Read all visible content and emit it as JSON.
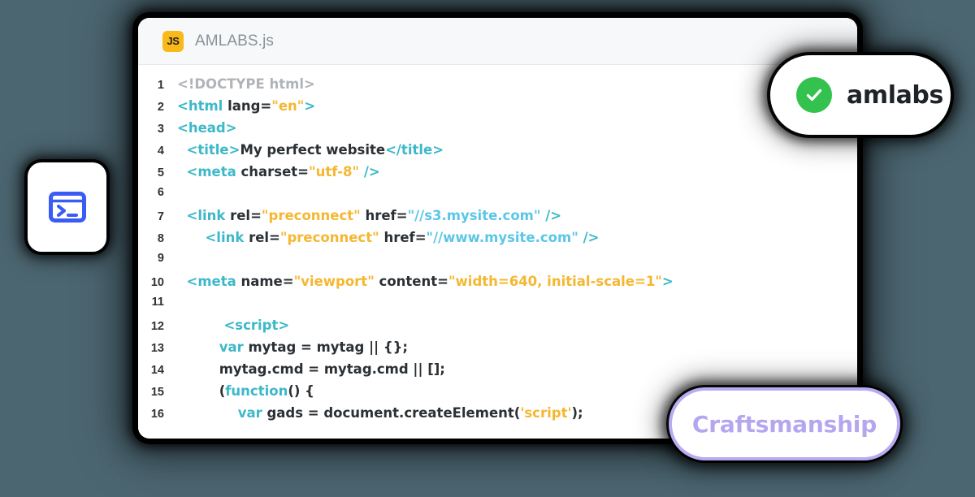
{
  "background_color": "#4c6671",
  "editor": {
    "file_badge": "JS",
    "file_badge_color": "#f9b918",
    "title": "AMLABS.js",
    "lines": [
      {
        "n": "1",
        "tokens": [
          {
            "t": "doctype",
            "v": "<!DOCTYPE html>"
          }
        ]
      },
      {
        "n": "2",
        "tokens": [
          {
            "t": "tag",
            "v": "<html "
          },
          {
            "t": "attr",
            "v": "lang="
          },
          {
            "t": "str",
            "v": "\"en\""
          },
          {
            "t": "tag",
            "v": ">"
          }
        ]
      },
      {
        "n": "3",
        "tokens": [
          {
            "t": "tag",
            "v": "<head>"
          }
        ]
      },
      {
        "n": "4",
        "tokens": [
          {
            "t": "plain",
            "v": "  "
          },
          {
            "t": "tag",
            "v": "<title>"
          },
          {
            "t": "plain",
            "v": "My perfect website"
          },
          {
            "t": "tag",
            "v": "</title>"
          }
        ]
      },
      {
        "n": "5",
        "tokens": [
          {
            "t": "plain",
            "v": "  "
          },
          {
            "t": "tag",
            "v": "<meta "
          },
          {
            "t": "attr",
            "v": "charset="
          },
          {
            "t": "str",
            "v": "\"utf-8\""
          },
          {
            "t": "plain",
            "v": " "
          },
          {
            "t": "tag",
            "v": "/>"
          }
        ]
      },
      {
        "n": "6",
        "tokens": []
      },
      {
        "n": "7",
        "tokens": [
          {
            "t": "plain",
            "v": "  "
          },
          {
            "t": "tag",
            "v": "<link "
          },
          {
            "t": "attr",
            "v": "rel="
          },
          {
            "t": "str",
            "v": "\"preconnect\""
          },
          {
            "t": "plain",
            "v": " "
          },
          {
            "t": "attr",
            "v": "href="
          },
          {
            "t": "url",
            "v": "\"//s3.mysite.com\""
          },
          {
            "t": "plain",
            "v": " "
          },
          {
            "t": "tag",
            "v": "/>"
          }
        ]
      },
      {
        "n": "8",
        "tokens": [
          {
            "t": "plain",
            "v": "      "
          },
          {
            "t": "tag",
            "v": "<link "
          },
          {
            "t": "attr",
            "v": "rel="
          },
          {
            "t": "str",
            "v": "\"preconnect\""
          },
          {
            "t": "plain",
            "v": " "
          },
          {
            "t": "attr",
            "v": "href="
          },
          {
            "t": "url",
            "v": "\"//www.mysite.com\""
          },
          {
            "t": "plain",
            "v": " "
          },
          {
            "t": "tag",
            "v": "/>"
          }
        ]
      },
      {
        "n": "9",
        "tokens": []
      },
      {
        "n": "10",
        "tokens": [
          {
            "t": "plain",
            "v": "  "
          },
          {
            "t": "tag",
            "v": "<meta "
          },
          {
            "t": "attr",
            "v": "name="
          },
          {
            "t": "str",
            "v": "\"viewport\""
          },
          {
            "t": "plain",
            "v": " "
          },
          {
            "t": "attr",
            "v": "content="
          },
          {
            "t": "str",
            "v": "\"width=640, initial-scale=1\""
          },
          {
            "t": "tag",
            "v": ">"
          }
        ]
      },
      {
        "n": "11",
        "tokens": []
      },
      {
        "n": "12",
        "tokens": [
          {
            "t": "plain",
            "v": "          "
          },
          {
            "t": "tag",
            "v": "<script>"
          }
        ]
      },
      {
        "n": "13",
        "tokens": [
          {
            "t": "plain",
            "v": "         "
          },
          {
            "t": "kw",
            "v": "var"
          },
          {
            "t": "plain",
            "v": " mytag = mytag || {};"
          }
        ]
      },
      {
        "n": "14",
        "tokens": [
          {
            "t": "plain",
            "v": "         mytag.cmd = mytag.cmd || [];"
          }
        ]
      },
      {
        "n": "15",
        "tokens": [
          {
            "t": "plain",
            "v": "         ("
          },
          {
            "t": "kw",
            "v": "function"
          },
          {
            "t": "plain",
            "v": "() {"
          }
        ]
      },
      {
        "n": "16",
        "tokens": [
          {
            "t": "plain",
            "v": "             "
          },
          {
            "t": "kw",
            "v": "var"
          },
          {
            "t": "plain",
            "v": " gads = document.createElement("
          },
          {
            "t": "str",
            "v": "'script'"
          },
          {
            "t": "plain",
            "v": ");"
          }
        ]
      }
    ]
  },
  "terminal_card": {
    "icon": "terminal-icon",
    "icon_color": "#3b5bf5"
  },
  "amlabs_badge": {
    "label": "amlabs",
    "check_color": "#33c24d"
  },
  "craftsmanship_badge": {
    "label": "Craftsmanship",
    "border_color": "#b9aaf2",
    "text_color": "#b5a6f0"
  }
}
